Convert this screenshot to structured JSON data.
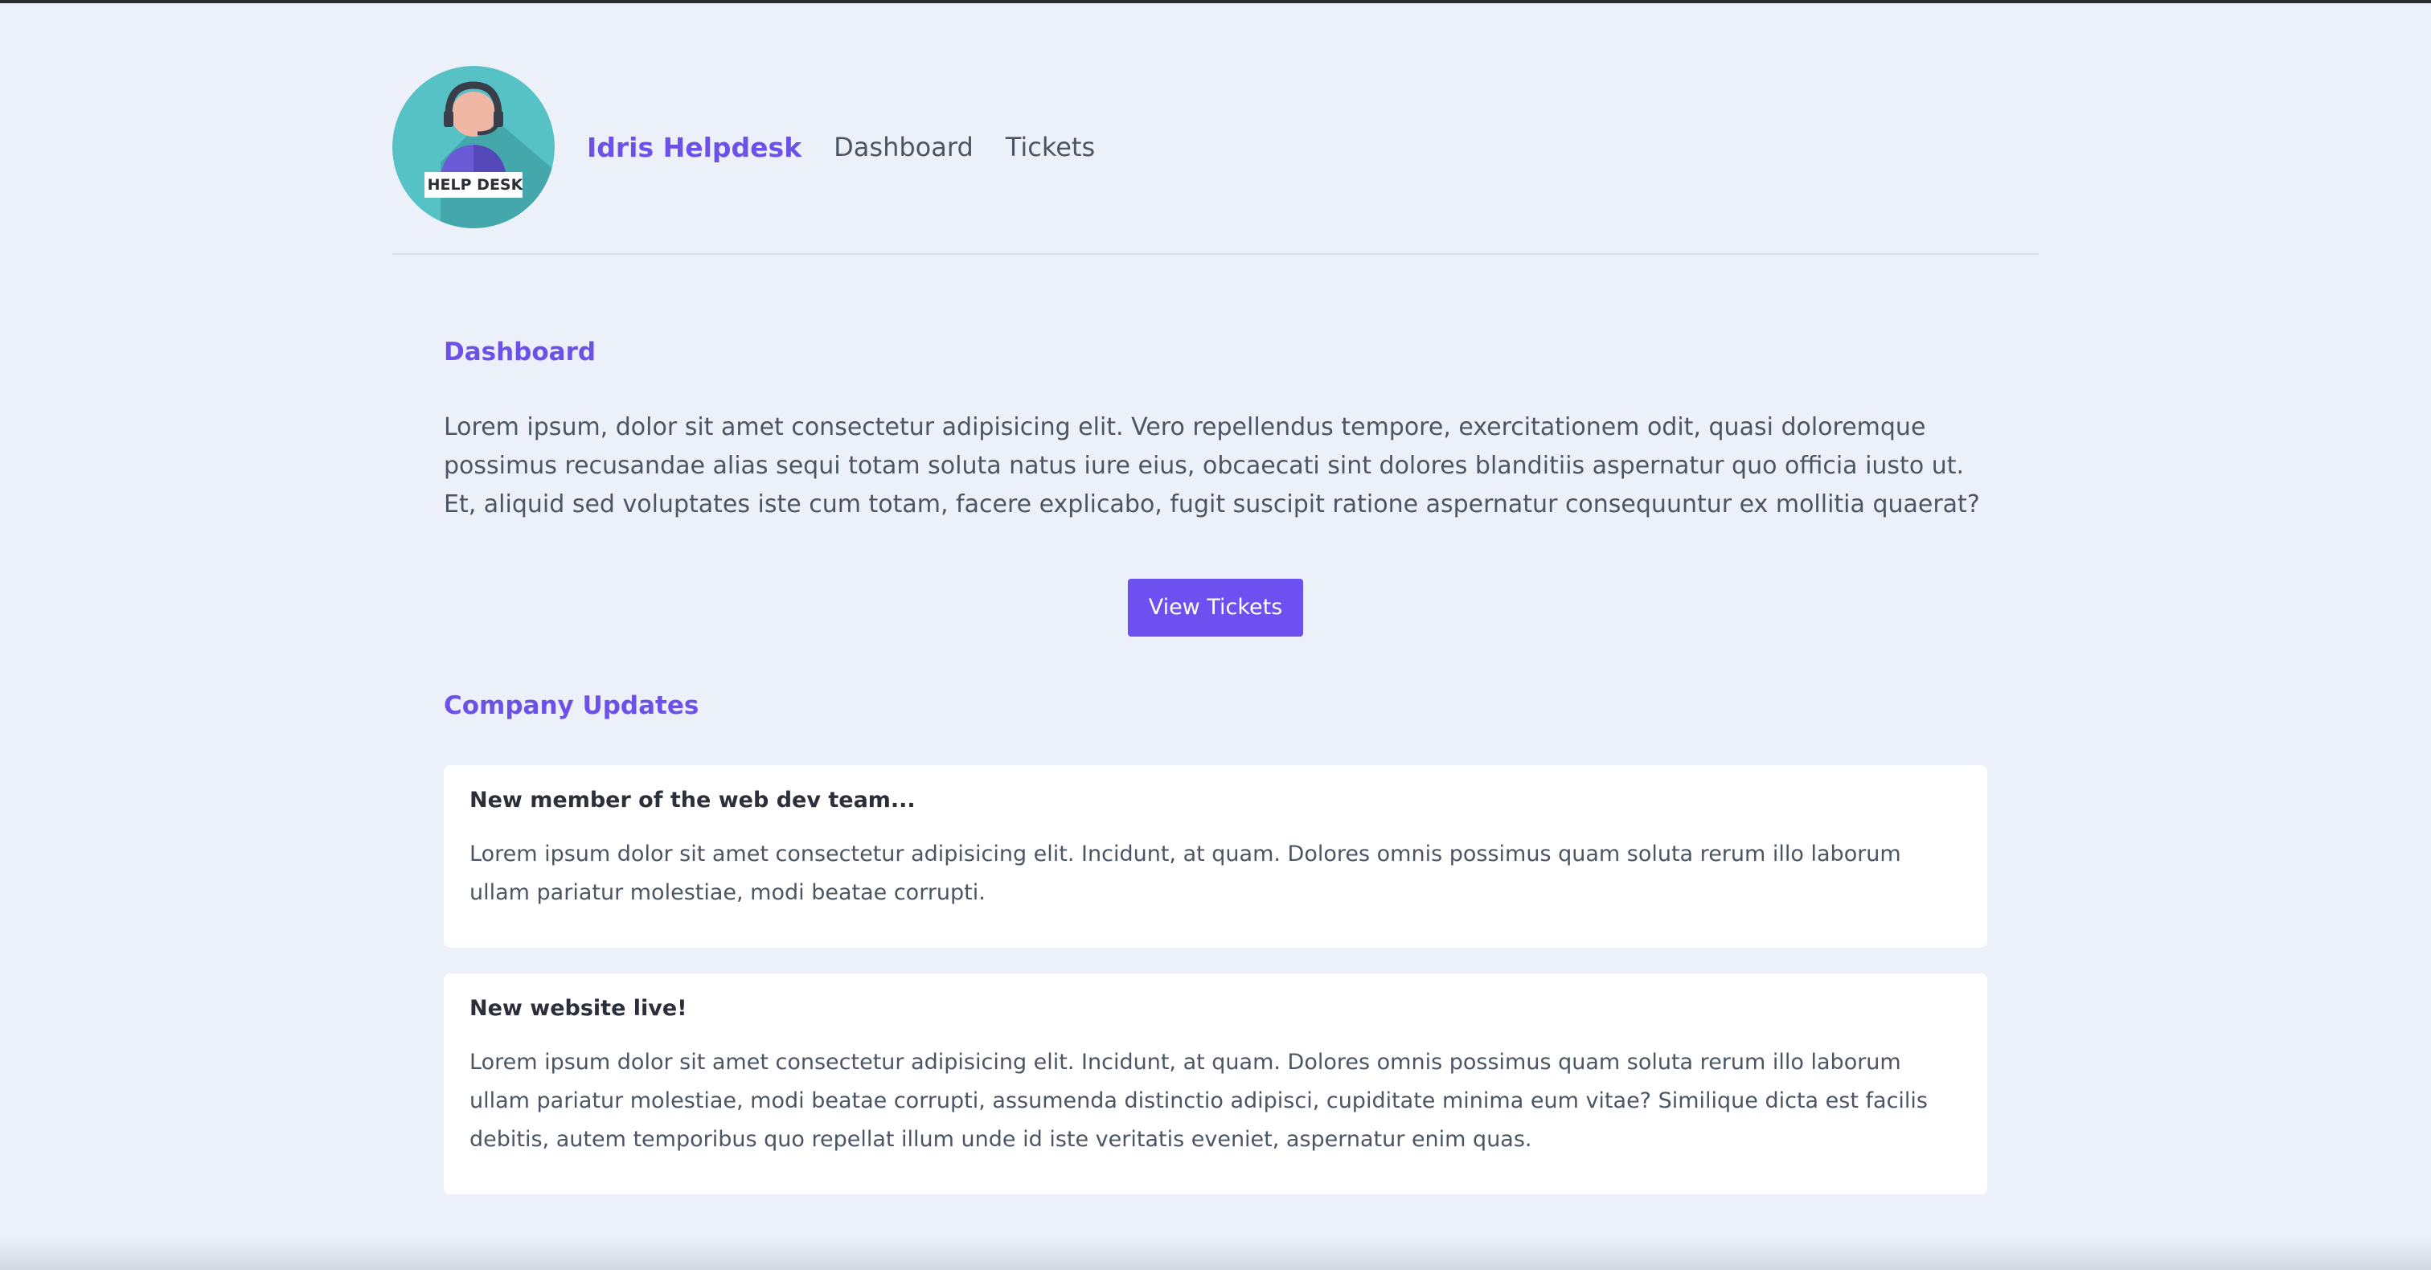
{
  "header": {
    "logo_text": "HELP DESK",
    "brand": "Idris Helpdesk",
    "nav": [
      {
        "label": "Dashboard"
      },
      {
        "label": "Tickets"
      }
    ]
  },
  "main": {
    "title": "Dashboard",
    "intro": "Lorem ipsum, dolor sit amet consectetur adipisicing elit. Vero repellendus tempore, exercitationem odit, quasi doloremque possimus recusandae alias sequi totam soluta natus iure eius, obcaecati sint dolores blanditiis aspernatur quo officia iusto ut. Et, aliquid sed voluptates iste cum totam, facere explicabo, fugit suscipit ratione aspernatur consequuntur ex mollitia quaerat?",
    "view_tickets_label": "View Tickets",
    "updates_title": "Company Updates",
    "updates": [
      {
        "title": "New member of the web dev team...",
        "body": "Lorem ipsum dolor sit amet consectetur adipisicing elit. Incidunt, at quam. Dolores omnis possimus quam soluta rerum illo laborum ullam pariatur molestiae, modi beatae corrupti."
      },
      {
        "title": "New website live!",
        "body": "Lorem ipsum dolor sit amet consectetur adipisicing elit. Incidunt, at quam. Dolores omnis possimus quam soluta rerum illo laborum ullam pariatur molestiae, modi beatae corrupti, assumenda distinctio adipisci, cupiditate minima eum vitae? Similique dicta est facilis debitis, autem temporibus quo repellat illum unde id iste veritatis eveniet, aspernatur enim quas."
      }
    ]
  },
  "colors": {
    "accent": "#6d50e8",
    "background": "#ecf0f8",
    "card": "#ffffff",
    "logo_teal": "#4fbcc0"
  }
}
